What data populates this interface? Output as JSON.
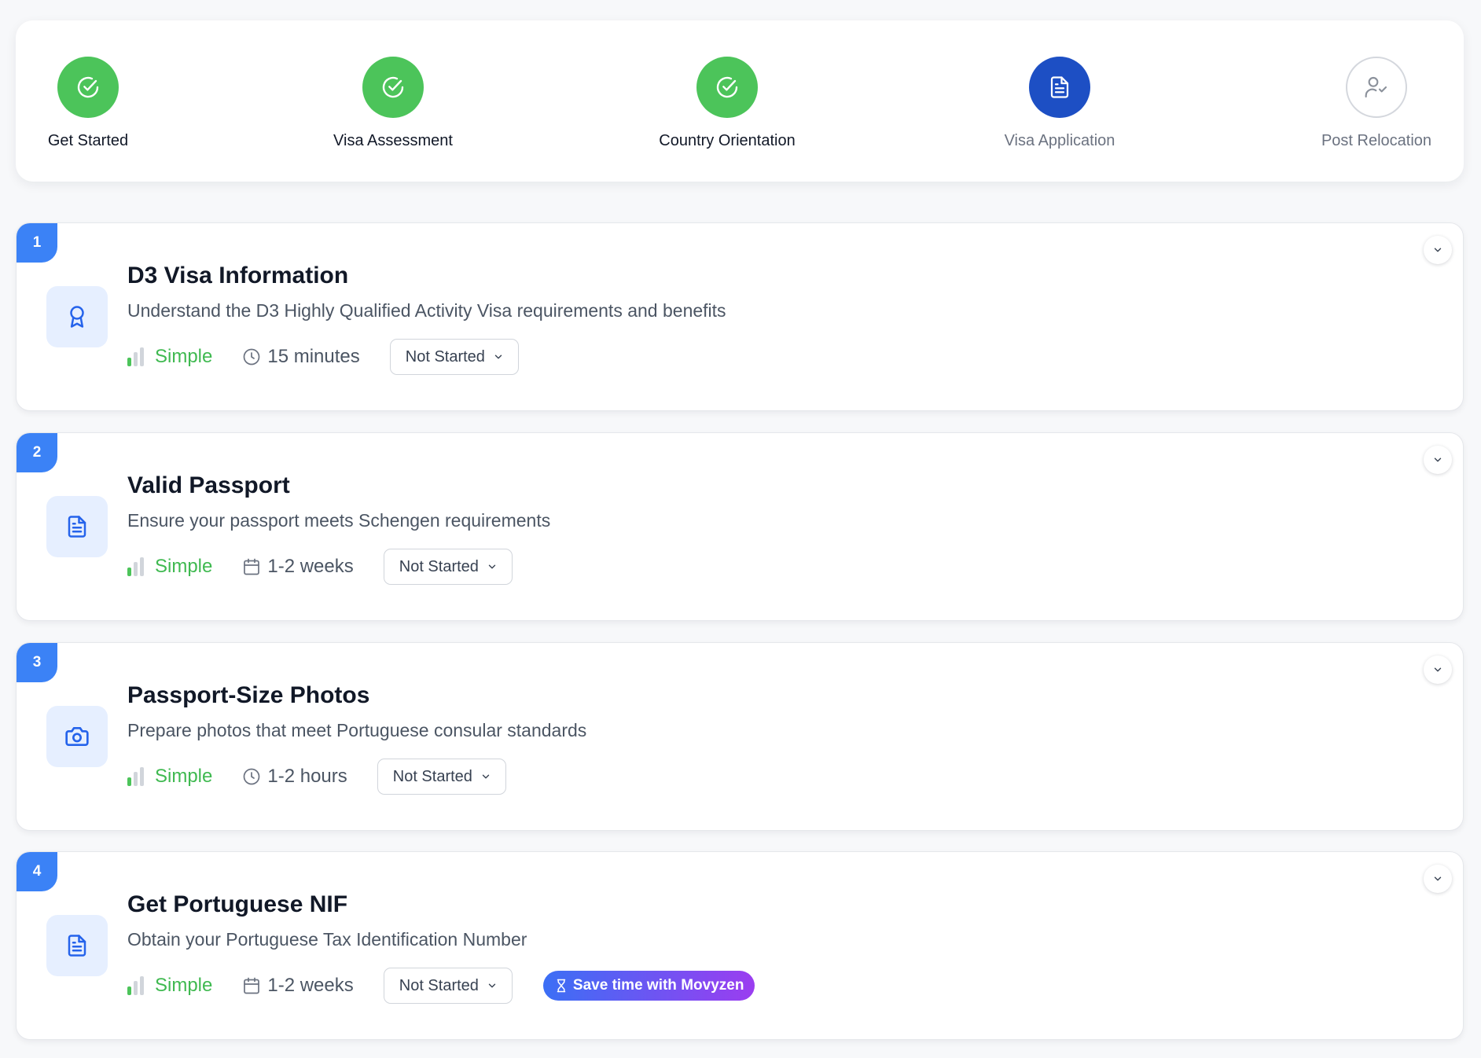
{
  "progress": {
    "steps": [
      {
        "label": "Get Started",
        "status": "completed"
      },
      {
        "label": "Visa Assessment",
        "status": "completed"
      },
      {
        "label": "Country Orientation",
        "status": "completed"
      },
      {
        "label": "Visa Application",
        "status": "current"
      },
      {
        "label": "Post Relocation",
        "status": "upcoming"
      }
    ]
  },
  "tasks": [
    {
      "number": "1",
      "title": "D3 Visa Information",
      "description": "Understand the D3 Highly Qualified Activity Visa requirements and benefits",
      "icon": "award-icon",
      "difficulty": "Simple",
      "duration": "15 minutes",
      "duration_icon": "clock-icon",
      "status": "Not Started"
    },
    {
      "number": "2",
      "title": "Valid Passport",
      "description": "Ensure your passport meets Schengen requirements",
      "icon": "document-icon",
      "difficulty": "Simple",
      "duration": "1-2 weeks",
      "duration_icon": "calendar-icon",
      "status": "Not Started"
    },
    {
      "number": "3",
      "title": "Passport-Size Photos",
      "description": "Prepare photos that meet Portuguese consular standards",
      "icon": "camera-icon",
      "difficulty": "Simple",
      "duration": "1-2 hours",
      "duration_icon": "clock-icon",
      "status": "Not Started"
    },
    {
      "number": "4",
      "title": "Get Portuguese NIF",
      "description": "Obtain your Portuguese Tax Identification Number",
      "icon": "document-icon",
      "difficulty": "Simple",
      "duration": "1-2 weeks",
      "duration_icon": "calendar-icon",
      "status": "Not Started",
      "promo": "Save time with Movyzen",
      "promo_icon": "hourglass-icon"
    }
  ],
  "colors": {
    "completed": "#4cc45a",
    "current": "#1d4fc4",
    "badge": "#3b82f6",
    "difficulty_simple": "#3fb950"
  }
}
